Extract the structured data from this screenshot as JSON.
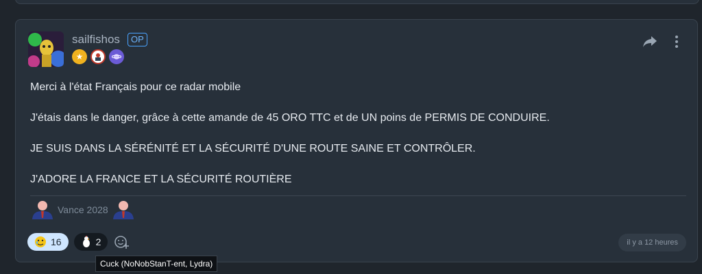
{
  "post": {
    "username": "sailfishos",
    "op_label": "OP",
    "lines": [
      "Merci à l'état Français pour ce radar mobile",
      "J'étais dans le danger, grâce à cette amande de 45 ORO TTC et de UN poins de PERMIS DE CONDUIRE.",
      "JE SUIS DANS LA SÉRÉNITÉ ET LA SÉCURITÉ D'UNE ROUTE SAINE ET CONTRÔLER.",
      "J'ADORE LA FRANCE ET LA SÉCURITÉ ROUTIÈRE"
    ],
    "signature": "Vance 2028",
    "timestamp": "il y a 12 heures"
  },
  "reactions": [
    {
      "icon": "crying-face-icon",
      "count": "16"
    },
    {
      "icon": "chicken-icon",
      "count": "2"
    }
  ],
  "tooltip": "Cuck (NoNobStanT-ent, Lydra)",
  "colors": {
    "background": "#1f252c",
    "card": "#27303a",
    "accent": "#4aa3ff",
    "reaction_active": "#cfe6ff"
  }
}
